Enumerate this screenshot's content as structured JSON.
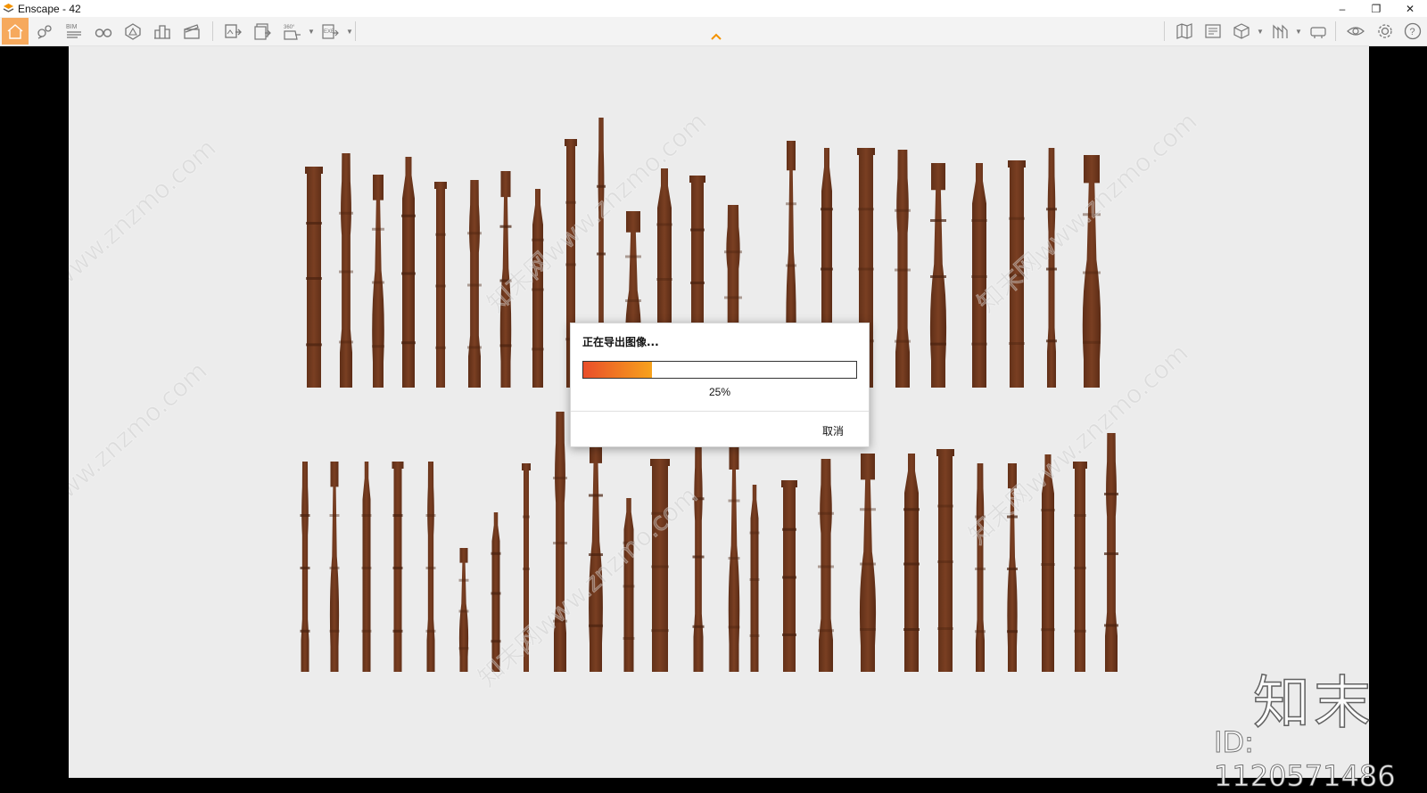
{
  "window": {
    "title": "Enscape - 42",
    "minimize_label": "–",
    "restore_label": "❐",
    "close_label": "✕"
  },
  "toolbar": {
    "left_buttons": [
      {
        "name": "home-icon",
        "active": true
      },
      {
        "name": "location-pins-icon"
      },
      {
        "name": "bim-icon",
        "text": "BIM"
      },
      {
        "name": "binoculars-icon"
      },
      {
        "name": "asset-library-icon"
      },
      {
        "name": "buildings-icon"
      },
      {
        "name": "video-editor-icon"
      },
      {
        "name": "export-image-icon"
      },
      {
        "name": "batch-render-icon"
      },
      {
        "name": "export-panorama-icon",
        "text": "360°"
      },
      {
        "name": "export-exe-icon",
        "text": "EXE"
      }
    ],
    "right_buttons": [
      {
        "name": "map-icon"
      },
      {
        "name": "settings-panel-icon"
      },
      {
        "name": "cube-view-icon"
      },
      {
        "name": "view-mode-icon"
      },
      {
        "name": "vr-headset-icon"
      },
      {
        "name": "visibility-icon"
      },
      {
        "name": "gear-icon"
      },
      {
        "name": "help-icon",
        "text": "?"
      }
    ],
    "accent_color": "#f6a95d"
  },
  "dialog": {
    "title": "正在导出图像...",
    "progress": 0.25,
    "percent_label": "25%",
    "cancel_label": "取消",
    "progress_colors": [
      "#e94e2a",
      "#f7a21c"
    ]
  },
  "watermark": {
    "logo_text": "知末",
    "id_text": "ID: 1120571486",
    "tile_text": "知末网www.znzmo.com"
  },
  "scene": {
    "background": "#ececec",
    "wood_color": "#7a3f22"
  }
}
